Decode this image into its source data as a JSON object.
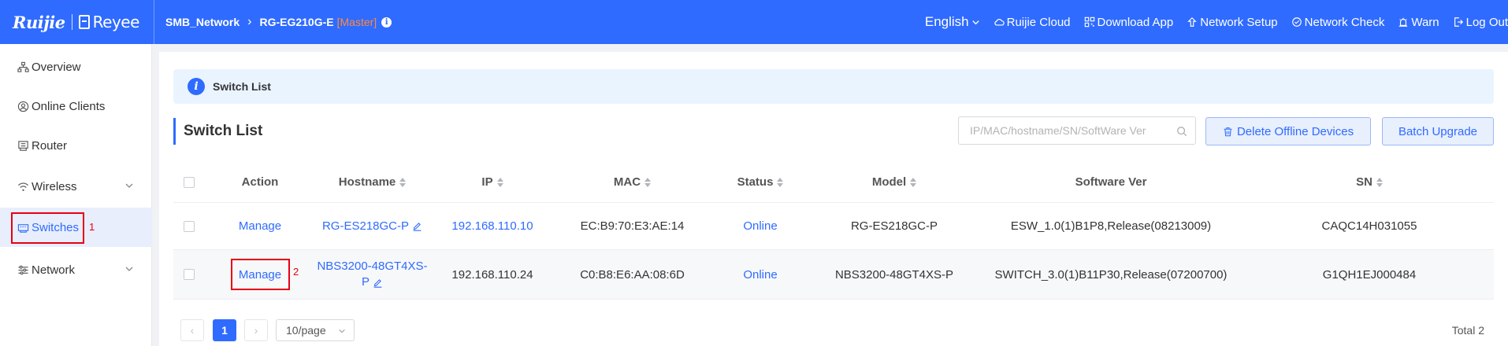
{
  "header": {
    "logo_ruijie": "Ruijie",
    "logo_reyee": "Reyee",
    "network": "SMB_Network",
    "device": "RG-EG210G-E",
    "role": "[Master]",
    "language": "English",
    "nav": {
      "cloud": "Ruijie Cloud",
      "download": "Download App",
      "setup": "Network Setup",
      "check": "Network Check",
      "warn": "Warn",
      "logout": "Log Out"
    }
  },
  "sidebar": {
    "items": [
      {
        "label": "Overview"
      },
      {
        "label": "Online Clients"
      },
      {
        "label": "Router"
      },
      {
        "label": "Wireless"
      },
      {
        "label": "Switches"
      },
      {
        "label": "Network"
      }
    ]
  },
  "annotations": {
    "first": "1",
    "second": "2"
  },
  "main": {
    "banner": "Switch List",
    "title": "Switch List",
    "search_placeholder": "IP/MAC/hostname/SN/SoftWare Ver",
    "delete_label": "Delete Offline Devices",
    "upgrade_label": "Batch Upgrade"
  },
  "table": {
    "headers": {
      "action": "Action",
      "hostname": "Hostname",
      "ip": "IP",
      "mac": "MAC",
      "status": "Status",
      "model": "Model",
      "software": "Software Ver",
      "sn": "SN"
    },
    "rows": [
      {
        "action": "Manage",
        "hostname": "RG-ES218GC-P",
        "hostname_line1": "RG-ES218GC-P",
        "hostname_line2": "",
        "ip": "192.168.110.10",
        "mac": "EC:B9:70:E3:AE:14",
        "status": "Online",
        "model": "RG-ES218GC-P",
        "software": "ESW_1.0(1)B1P8,Release(08213009)",
        "sn": "CAQC14H031055"
      },
      {
        "action": "Manage",
        "hostname_line1": "NBS3200-48GT4XS-",
        "hostname_line2": "P",
        "ip": "192.168.110.24",
        "mac": "C0:B8:E6:AA:08:6D",
        "status": "Online",
        "model": "NBS3200-48GT4XS-P",
        "software": "SWITCH_3.0(1)B11P30,Release(07200700)",
        "sn": "G1QH1EJ000484"
      }
    ]
  },
  "pagination": {
    "current_page": "1",
    "page_size": "10/page",
    "total": "Total 2"
  },
  "colors": {
    "brand": "#2f6bff",
    "annotation": "#e60012",
    "master": "#ff8a3d"
  }
}
